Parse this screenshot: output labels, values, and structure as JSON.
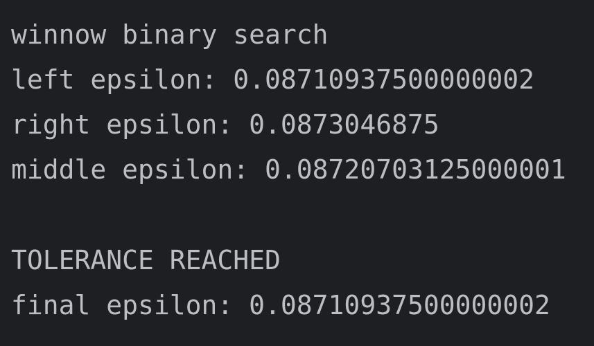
{
  "console": {
    "lines": [
      "winnow binary search",
      "left epsilon: 0.08710937500000002",
      "right epsilon: 0.0873046875",
      "middle epsilon: 0.08720703125000001",
      "",
      "TOLERANCE REACHED",
      "final epsilon: 0.08710937500000002"
    ],
    "colors": {
      "background": "#1e1f22",
      "text": "#bcbec4"
    }
  }
}
